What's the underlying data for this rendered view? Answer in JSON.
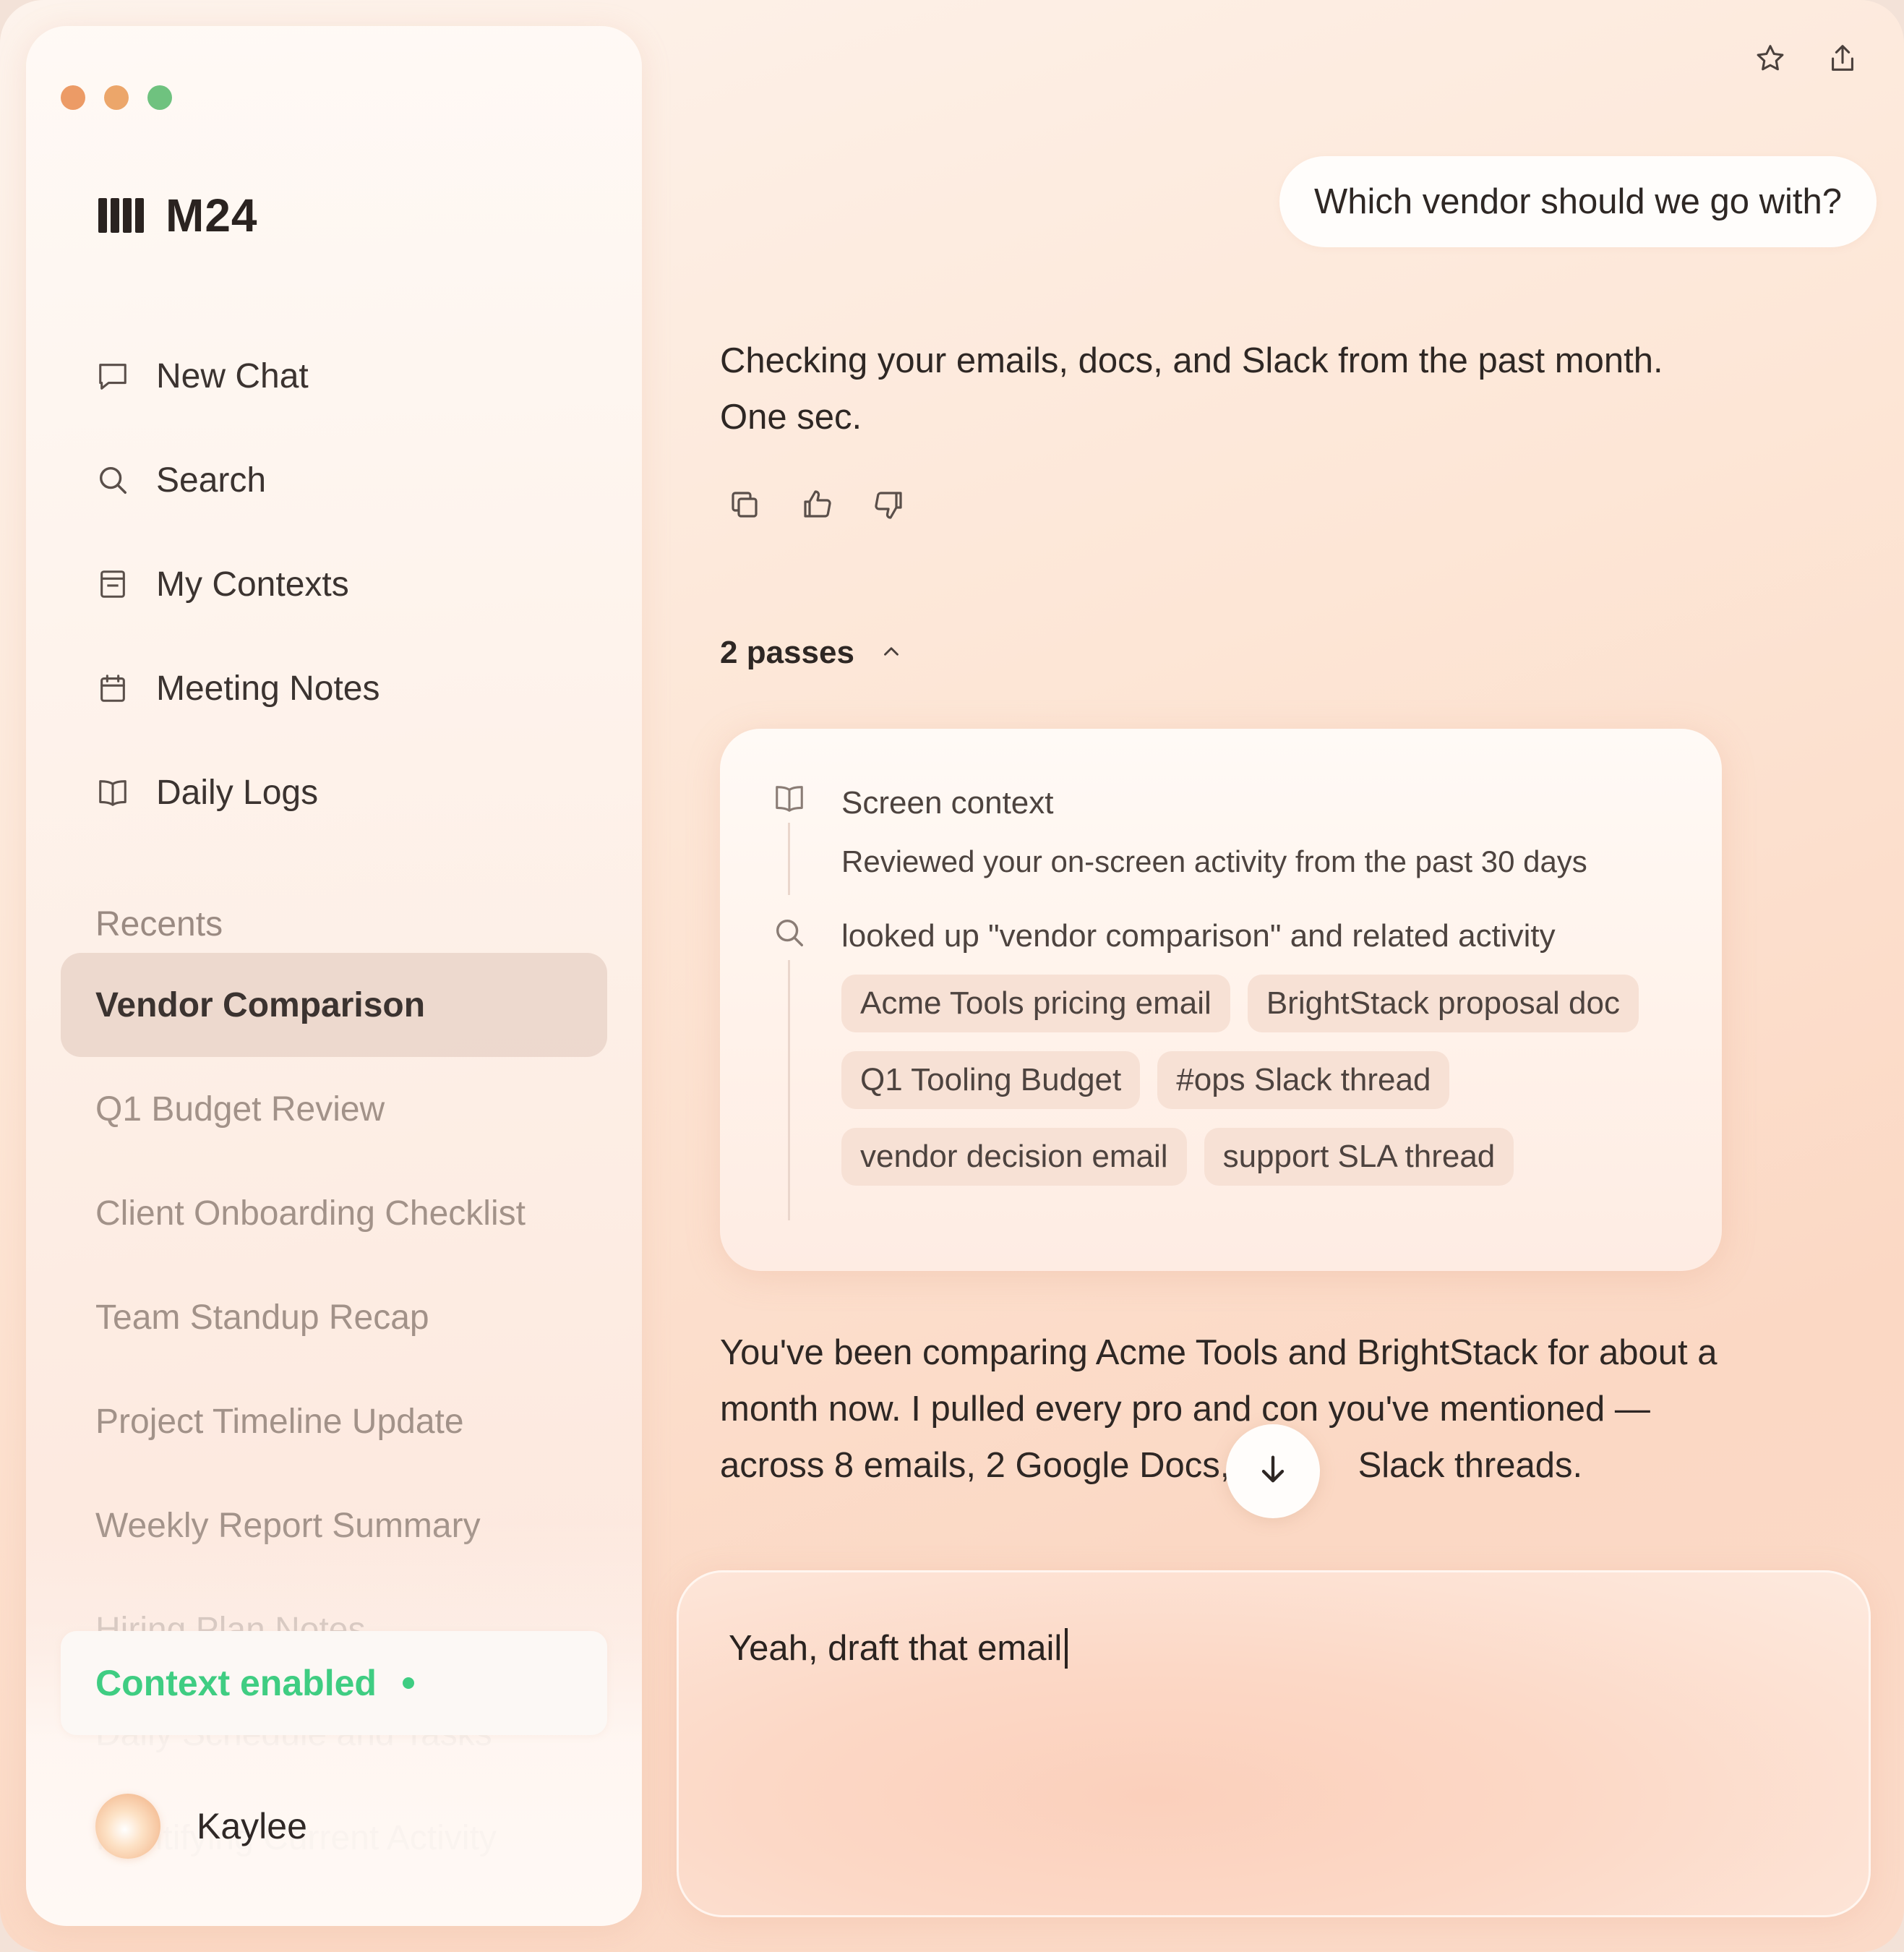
{
  "app": {
    "name": "M24"
  },
  "colors": {
    "accent_green": "#3fcd82",
    "chip_bg": "#f7e1d5",
    "active_row": "#e0c6ba"
  },
  "sidebar": {
    "nav": [
      {
        "label": "New Chat",
        "icon": "chat-bubble-icon"
      },
      {
        "label": "Search",
        "icon": "search-icon"
      },
      {
        "label": "My Contexts",
        "icon": "inbox-icon"
      },
      {
        "label": "Meeting Notes",
        "icon": "calendar-icon"
      },
      {
        "label": "Daily Logs",
        "icon": "book-icon"
      }
    ],
    "recents_heading": "Recents",
    "recents": [
      "Vendor Comparison",
      "Q1 Budget Review",
      "Client Onboarding Checklist",
      "Team Standup Recap",
      "Project Timeline Update",
      "Weekly Report Summary",
      "Hiring Plan Notes",
      "Daily Schedule and Tasks",
      "Identifying Current Activity"
    ],
    "context_toggle": "Context enabled",
    "user_name": "Kaylee"
  },
  "chat": {
    "user_message": "Which vendor should we go with?",
    "ai_message_1": "Checking your emails, docs, and Slack from the past month. One sec.",
    "passes_label": "2 passes",
    "steps": [
      {
        "title": "Screen context",
        "subtitle": "Reviewed your on-screen activity from the past 30 days",
        "icon": "book-icon"
      },
      {
        "title": "looked up \"vendor comparison\" and related activity",
        "icon": "search-icon"
      }
    ],
    "sources": [
      "Acme Tools pricing email",
      "BrightStack proposal doc",
      "Q1 Tooling Budget",
      "#ops Slack thread",
      "vendor decision email",
      "support SLA thread"
    ],
    "ai_message_2_line1": "You've been comparing Acme Tools and BrightStack for about a",
    "ai_message_2_line2": "month now. I pulled every pro and con you've mentioned —",
    "ai_message_2_line3a": "across 8 emails, 2 Google Docs, ",
    "ai_message_2_line3b": " Slack threads."
  },
  "composer": {
    "value": "Yeah, draft that email"
  }
}
